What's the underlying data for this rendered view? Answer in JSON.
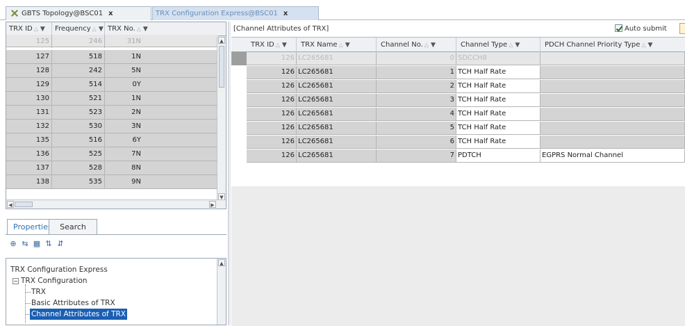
{
  "tabs": [
    {
      "label": "GBTS Topology@BSC01",
      "close": "x"
    },
    {
      "label": "TRX Configuration Express@BSC01",
      "close": "x"
    }
  ],
  "trx_list": {
    "columns": [
      {
        "label": "TRX ID"
      },
      {
        "label": "Frequency"
      },
      {
        "label": "TRX No."
      }
    ],
    "rows": [
      {
        "trx_id": "125",
        "frequency": "246",
        "trx_no": "31N"
      },
      {
        "trx_id": "127",
        "frequency": "518",
        "trx_no": "1N"
      },
      {
        "trx_id": "128",
        "frequency": "242",
        "trx_no": "5N"
      },
      {
        "trx_id": "129",
        "frequency": "514",
        "trx_no": "0Y"
      },
      {
        "trx_id": "130",
        "frequency": "521",
        "trx_no": "1N"
      },
      {
        "trx_id": "131",
        "frequency": "523",
        "trx_no": "2N"
      },
      {
        "trx_id": "132",
        "frequency": "530",
        "trx_no": "3N"
      },
      {
        "trx_id": "135",
        "frequency": "516",
        "trx_no": "6Y"
      },
      {
        "trx_id": "136",
        "frequency": "525",
        "trx_no": "7N"
      },
      {
        "trx_id": "137",
        "frequency": "528",
        "trx_no": "8N"
      },
      {
        "trx_id": "138",
        "frequency": "535",
        "trx_no": "9N"
      }
    ]
  },
  "properties_panel": {
    "tabs": [
      "Properties",
      "Search"
    ],
    "tree": {
      "root": "TRX Configuration Express",
      "group": "TRX Configuration",
      "children": [
        "TRX",
        "Basic Attributes of TRX",
        "Channel Attributes of TRX"
      ]
    }
  },
  "channel_panel": {
    "title": "[Channel Attributes of TRX]",
    "auto_submit": "Auto submit",
    "columns": [
      {
        "label": "TRX ID"
      },
      {
        "label": "TRX Name"
      },
      {
        "label": "Channel No."
      },
      {
        "label": "Channel Type"
      },
      {
        "label": "PDCH Channel Priority Type"
      }
    ],
    "rows": [
      {
        "trx_id": "126",
        "trx_name": "LC265681",
        "channel_no": "0",
        "channel_type": "SDCCH8",
        "priority": ""
      },
      {
        "trx_id": "126",
        "trx_name": "LC265681",
        "channel_no": "1",
        "channel_type": "TCH Half Rate",
        "priority": ""
      },
      {
        "trx_id": "126",
        "trx_name": "LC265681",
        "channel_no": "2",
        "channel_type": "TCH Half Rate",
        "priority": ""
      },
      {
        "trx_id": "126",
        "trx_name": "LC265681",
        "channel_no": "3",
        "channel_type": "TCH Half Rate",
        "priority": ""
      },
      {
        "trx_id": "126",
        "trx_name": "LC265681",
        "channel_no": "4",
        "channel_type": "TCH Half Rate",
        "priority": ""
      },
      {
        "trx_id": "126",
        "trx_name": "LC265681",
        "channel_no": "5",
        "channel_type": "TCH Half Rate",
        "priority": ""
      },
      {
        "trx_id": "126",
        "trx_name": "LC265681",
        "channel_no": "6",
        "channel_type": "TCH Half Rate",
        "priority": ""
      },
      {
        "trx_id": "126",
        "trx_name": "LC265681",
        "channel_no": "7",
        "channel_type": "PDTCH",
        "priority": "EGPRS Normal Channel"
      }
    ]
  }
}
